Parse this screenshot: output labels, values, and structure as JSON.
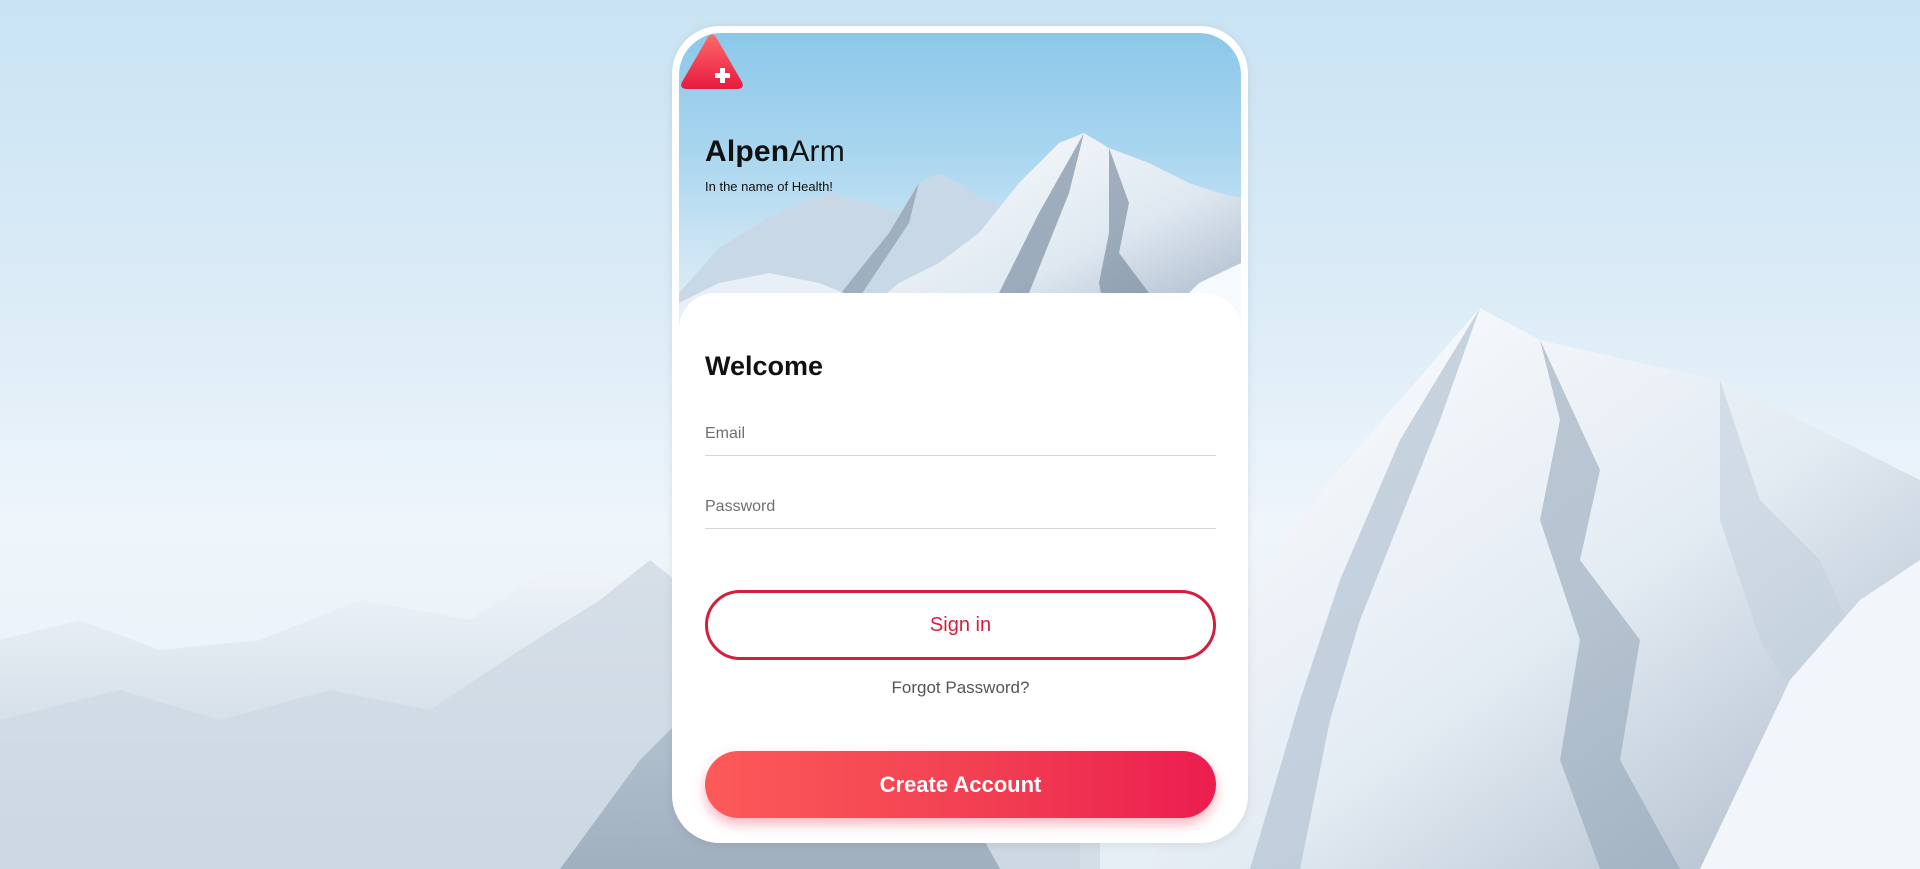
{
  "app": {
    "brand_bold": "Alpen",
    "brand_light": "Arm",
    "tagline": "In the name of Health!"
  },
  "login": {
    "heading": "Welcome",
    "email_placeholder": "Email",
    "password_placeholder": "Password",
    "sign_in_label": "Sign in",
    "forgot_label": "Forgot Password?",
    "create_account_label": "Create Account"
  },
  "icons": {
    "logo": "triangle-cross-logo-icon"
  },
  "colors": {
    "accent": "#d21f3c",
    "gradient_start": "#fc5a59",
    "gradient_end": "#ec1d4f"
  }
}
